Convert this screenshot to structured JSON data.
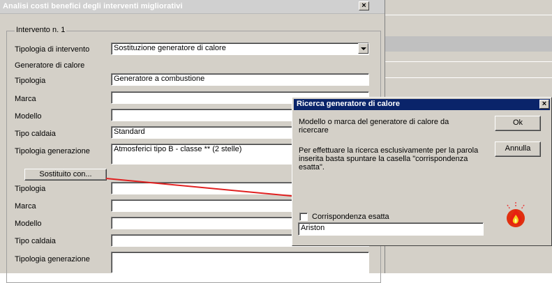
{
  "main_window": {
    "title": "Analisi costi benefici degli interventi migliorativi",
    "close": "×"
  },
  "group": {
    "legend": "Intervento n. 1"
  },
  "form": {
    "tipologia_intervento_label": "Tipologia di intervento",
    "tipologia_intervento_value": "Sostituzione generatore di calore",
    "generatore_section_label": "Generatore di calore",
    "tipologia_label": "Tipologia",
    "tipologia_value": "Generatore a combustione",
    "marca_label": "Marca",
    "marca_value": "",
    "modello_label": "Modello",
    "modello_value": "",
    "tipo_caldaia_label": "Tipo caldaia",
    "tipo_caldaia_value": "Standard",
    "tipologia_generazione_label": "Tipologia generazione",
    "tipologia_generazione_value": "Atmosferici tipo B - classe ** (2 stelle)",
    "sostituito_button": "Sostituito con...",
    "new_tipologia_label": "Tipologia",
    "new_tipologia_value": "",
    "new_marca_label": "Marca",
    "new_marca_value": "",
    "new_modello_label": "Modello",
    "new_modello_value": "",
    "new_tipo_caldaia_label": "Tipo caldaia",
    "new_tipo_caldaia_value": "",
    "new_tipologia_generazione_label": "Tipologia generazione",
    "new_tipologia_generazione_value": ""
  },
  "dialog": {
    "title": "Ricerca generatore di calore",
    "close": "×",
    "prompt_line1": "Modello o marca del generatore di calore da",
    "prompt_line2": "ricercare",
    "info_line1": "Per effettuare la ricerca esclusivamente per la parola",
    "info_line2": "inserita basta spuntare la casella \"corrispondenza",
    "info_line3": "esatta\".",
    "ok_button": "Ok",
    "cancel_button": "Annulla",
    "exact_match_label": "Corrispondenza esatta",
    "exact_match_checked": false,
    "search_value": "Ariston",
    "icon": "flame-icon"
  },
  "colors": {
    "dialog_title_bg": "#0a246a",
    "annotation_line": "#e02020"
  }
}
